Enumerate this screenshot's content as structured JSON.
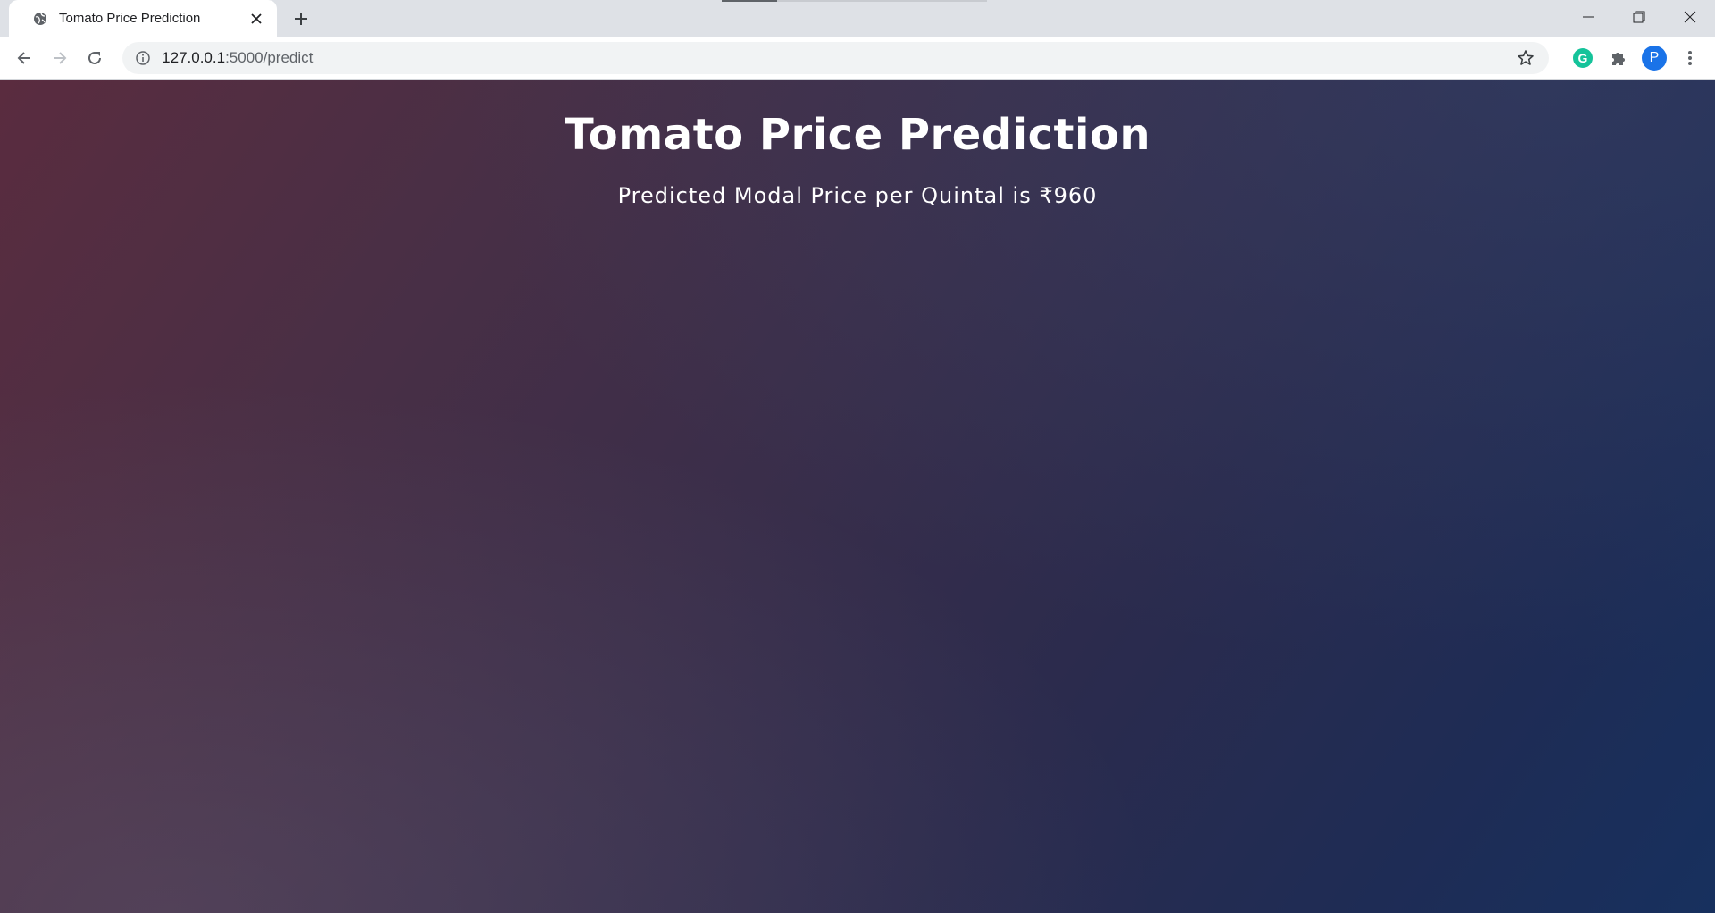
{
  "browser": {
    "tab": {
      "title": "Tomato Price Prediction",
      "favicon": "globe-icon"
    },
    "address_bar": {
      "host": "127.0.0.1",
      "path": ":5000/predict"
    },
    "profile_initial": "P",
    "extensions": [
      "grammarly-icon",
      "puzzle-icon"
    ]
  },
  "page": {
    "title": "Tomato Price Prediction",
    "prediction_text": "Predicted Modal Price per Quintal is ₹960"
  },
  "colors": {
    "gradient_start": "#5a2c3f",
    "gradient_end": "#17305e",
    "text": "#ffffff"
  }
}
